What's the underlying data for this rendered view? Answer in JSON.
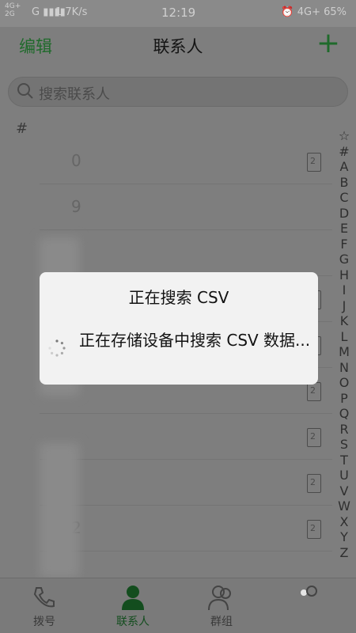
{
  "status": {
    "network_left": "4G+\n2G",
    "carrier_left": "G",
    "speed": "1.7K/s",
    "time": "12:19",
    "right": "4G+ 65%"
  },
  "header": {
    "edit": "编辑",
    "title": "联系人",
    "add": "+"
  },
  "search": {
    "placeholder": "搜索联系人"
  },
  "section": "#",
  "rows": [
    {
      "text": "0",
      "badge": "2"
    },
    {
      "text": "9",
      "badge": ""
    },
    {
      "text": "",
      "badge": ""
    },
    {
      "text": "",
      "badge": "2"
    },
    {
      "text": "",
      "badge": "2"
    },
    {
      "text": "",
      "badge": "2"
    },
    {
      "text": "",
      "badge": "2"
    },
    {
      "text": "",
      "badge": "2"
    },
    {
      "text": "2",
      "badge": "2"
    }
  ],
  "index": [
    "☆",
    "#",
    "A",
    "B",
    "C",
    "D",
    "E",
    "F",
    "G",
    "H",
    "I",
    "J",
    "K",
    "L",
    "M",
    "N",
    "O",
    "P",
    "Q",
    "R",
    "S",
    "T",
    "U",
    "V",
    "W",
    "X",
    "Y",
    "Z"
  ],
  "tabs": [
    {
      "label": "拨号",
      "icon": "phone-icon"
    },
    {
      "label": "联系人",
      "icon": "person-icon"
    },
    {
      "label": "群组",
      "icon": "group-icon"
    },
    {
      "label": "",
      "icon": "more-icon"
    }
  ],
  "dialog": {
    "title": "正在搜索 CSV",
    "message": "正在存储设备中搜索 CSV 数据..."
  },
  "colors": {
    "accent": "#1f6a2b",
    "overlay": "#7e7e7e",
    "dialog": "#f2f2f2"
  }
}
